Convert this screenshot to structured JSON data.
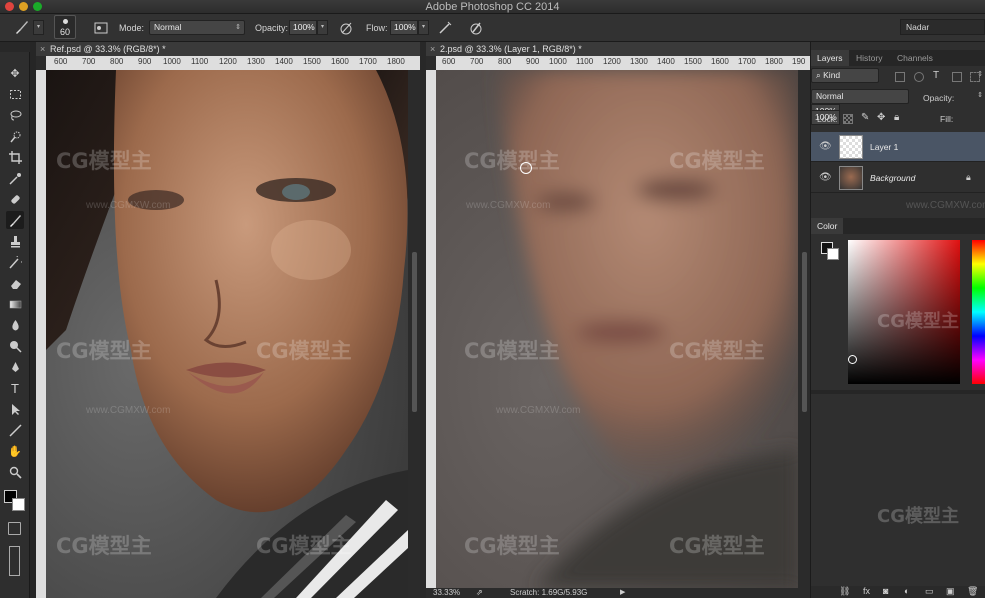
{
  "app": {
    "title": "Adobe Photoshop CC 2014"
  },
  "options_bar": {
    "brush_size": "60",
    "mode_label": "Mode:",
    "mode_value": "Normal",
    "opacity_label": "Opacity:",
    "opacity_value": "100%",
    "flow_label": "Flow:",
    "flow_value": "100%",
    "workspace": "Nadar"
  },
  "documents": [
    {
      "tab": "Ref.psd @ 33.3% (RGB/8*) *",
      "ruler": [
        "600",
        "700",
        "800",
        "900",
        "1000",
        "1100",
        "1200",
        "1300",
        "1400",
        "1500",
        "1600",
        "1700",
        "1800"
      ]
    },
    {
      "tab": "2.psd @ 33.3% (Layer 1, RGB/8*) *",
      "ruler": [
        "600",
        "700",
        "800",
        "900",
        "1000",
        "1100",
        "1200",
        "1300",
        "1400",
        "1500",
        "1600",
        "1700",
        "1800",
        "190"
      ]
    }
  ],
  "status": {
    "zoom": "33.33%",
    "scratch": "Scratch: 1.69G/5.93G"
  },
  "layers_panel": {
    "tabs": [
      "Layers",
      "History",
      "Channels"
    ],
    "kind_label": "Kind",
    "blend_mode": "Normal",
    "opacity_label": "Opacity:",
    "opacity_value": "100%",
    "lock_label": "Lock:",
    "fill_label": "Fill:",
    "fill_value": "100%",
    "layers": [
      {
        "name": "Layer 1",
        "selected": true
      },
      {
        "name": "Background",
        "selected": false,
        "locked": true
      }
    ]
  },
  "color_panel": {
    "title": "Color"
  },
  "watermark": {
    "brand": "CG模型主",
    "url": "www.CGMXW.com"
  },
  "colors": {
    "accent": "#4a5565",
    "panel": "#2f2f2f",
    "ruler": "#dedede"
  }
}
